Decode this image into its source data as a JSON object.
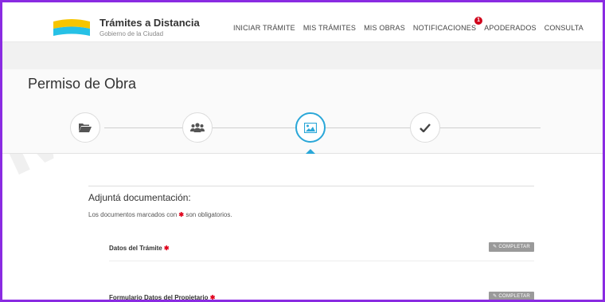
{
  "header": {
    "brand_title": "Trámites a Distancia",
    "brand_subtitle": "Gobierno de la Ciudad",
    "nav": [
      {
        "label": "INICIAR TRÁMITE"
      },
      {
        "label": "MIS TRÁMITES"
      },
      {
        "label": "MIS OBRAS"
      },
      {
        "label": "NOTIFICACIONES",
        "badge": "1"
      },
      {
        "label": "APODERADOS"
      },
      {
        "label": "CONSULTA"
      }
    ]
  },
  "page": {
    "title": "Permiso de Obra"
  },
  "stepper": {
    "steps": [
      {
        "icon": "folder-icon"
      },
      {
        "icon": "people-icon"
      },
      {
        "icon": "image-icon",
        "active": true
      },
      {
        "icon": "check-icon"
      }
    ],
    "active_index": 2
  },
  "documents": {
    "title": "Adjuntá documentación:",
    "note_before": "Los documentos marcados con",
    "note_after": "son obligatorios.",
    "items": [
      {
        "label": "Datos del Trámite",
        "button": "COMPLETAR"
      },
      {
        "label": "Formulario Datos del Propietario",
        "button": "COMPLETAR"
      }
    ]
  },
  "colors": {
    "accent": "#2aa7d8",
    "required": "#e0001b",
    "frame": "#8a2be2"
  }
}
